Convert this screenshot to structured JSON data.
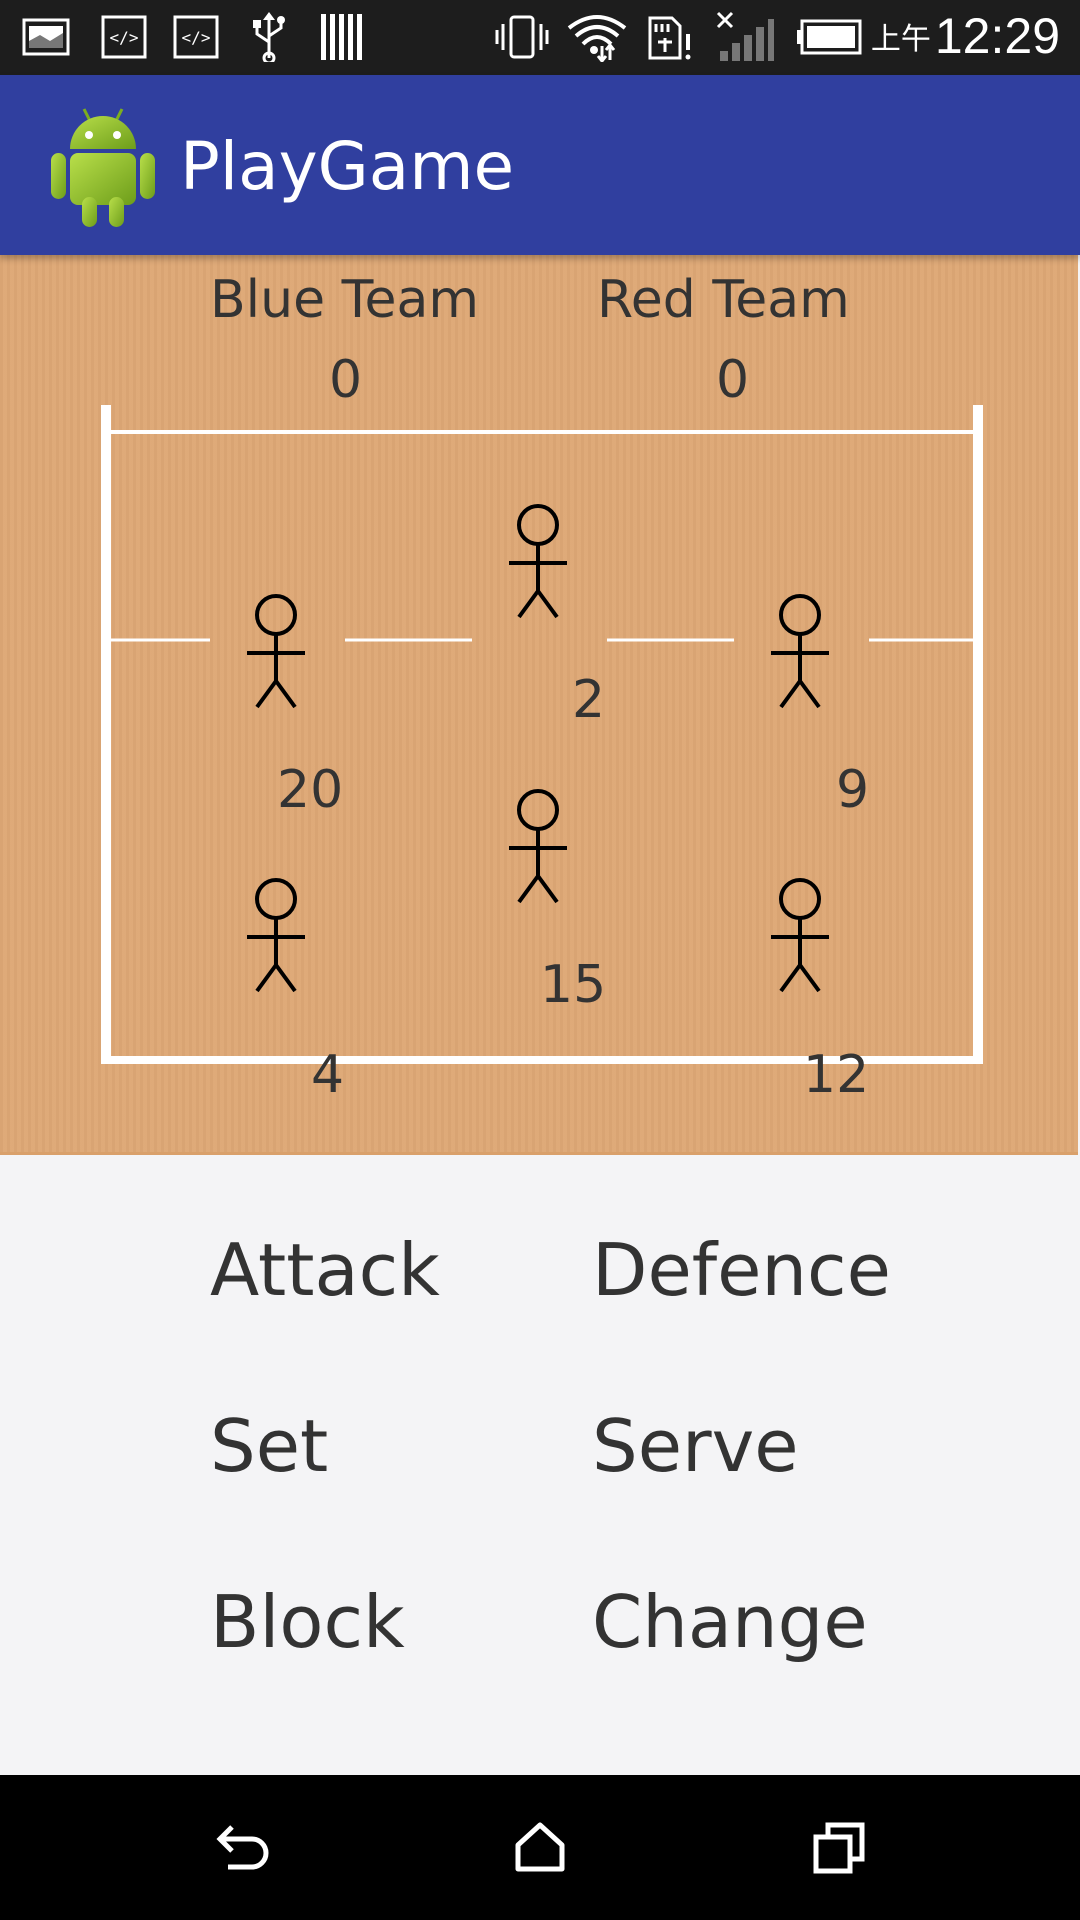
{
  "status_bar": {
    "ampm": "上午",
    "time": "12:29",
    "left_icons": [
      "image-icon",
      "code-icon",
      "code-icon",
      "usb-icon",
      "barcode-icon"
    ],
    "right_icons": [
      "vibrate-icon",
      "wifi-icon",
      "sd-card-alert-icon",
      "no-signal-icon",
      "battery-icon"
    ]
  },
  "app_bar": {
    "title": "PlayGame",
    "logo": "android-robot-icon"
  },
  "scoreboard": {
    "blue_team_label": "Blue Team",
    "red_team_label": "Red Team",
    "blue_score": "0",
    "red_score": "0"
  },
  "players": [
    {
      "number": "20"
    },
    {
      "number": "2"
    },
    {
      "number": "9"
    },
    {
      "number": "4"
    },
    {
      "number": "15"
    },
    {
      "number": "12"
    }
  ],
  "actions": {
    "attack": "Attack",
    "defence": "Defence",
    "set": "Set",
    "serve": "Serve",
    "block": "Block",
    "change": "Change"
  },
  "nav_bar": {
    "back": "back-icon",
    "home": "home-icon",
    "recents": "recents-icon"
  },
  "colors": {
    "app_bar": "#303f9f",
    "court": "#dea876",
    "court_lines": "#ffffff",
    "background": "#f4f4f6"
  }
}
